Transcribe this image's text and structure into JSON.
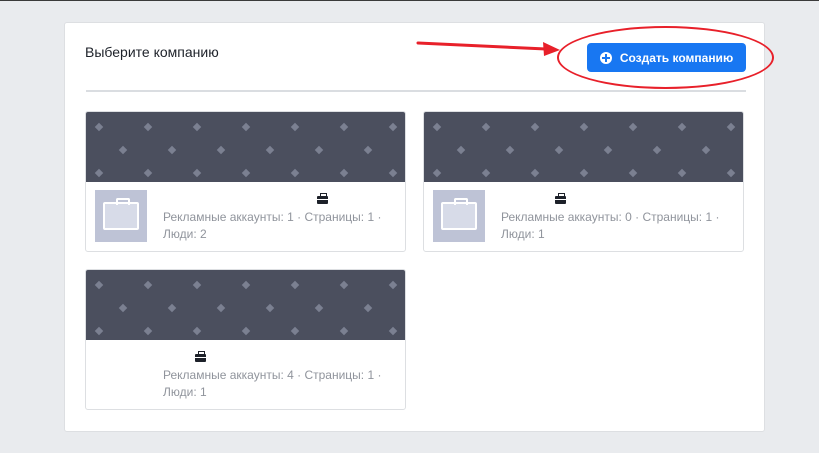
{
  "panel": {
    "title": "Выберите компанию",
    "create_button_label": "Создать компанию"
  },
  "companies": [
    {
      "name": "",
      "stats_line1": "Рекламные аккаунты: 1 · Страницы: 1 ·",
      "stats_line2": "Люди: 2"
    },
    {
      "name": "",
      "stats_line1": "Рекламные аккаунты: 0 · Страницы: 1 ·",
      "stats_line2": "Люди: 1"
    },
    {
      "name": "",
      "stats_line1": "Рекламные аккаунты: 4 · Страницы: 1 ·",
      "stats_line2": "Люди: 1"
    }
  ],
  "icons": {
    "create_button": "plus-circle-icon",
    "company_badge": "briefcase-icon",
    "company_thumbnail": "briefcase-placeholder-icon"
  },
  "colors": {
    "primary_button": "#1877f2",
    "annotation": "#e8202a",
    "cover": "#4b4f5e",
    "page_background": "#e9ebee"
  }
}
